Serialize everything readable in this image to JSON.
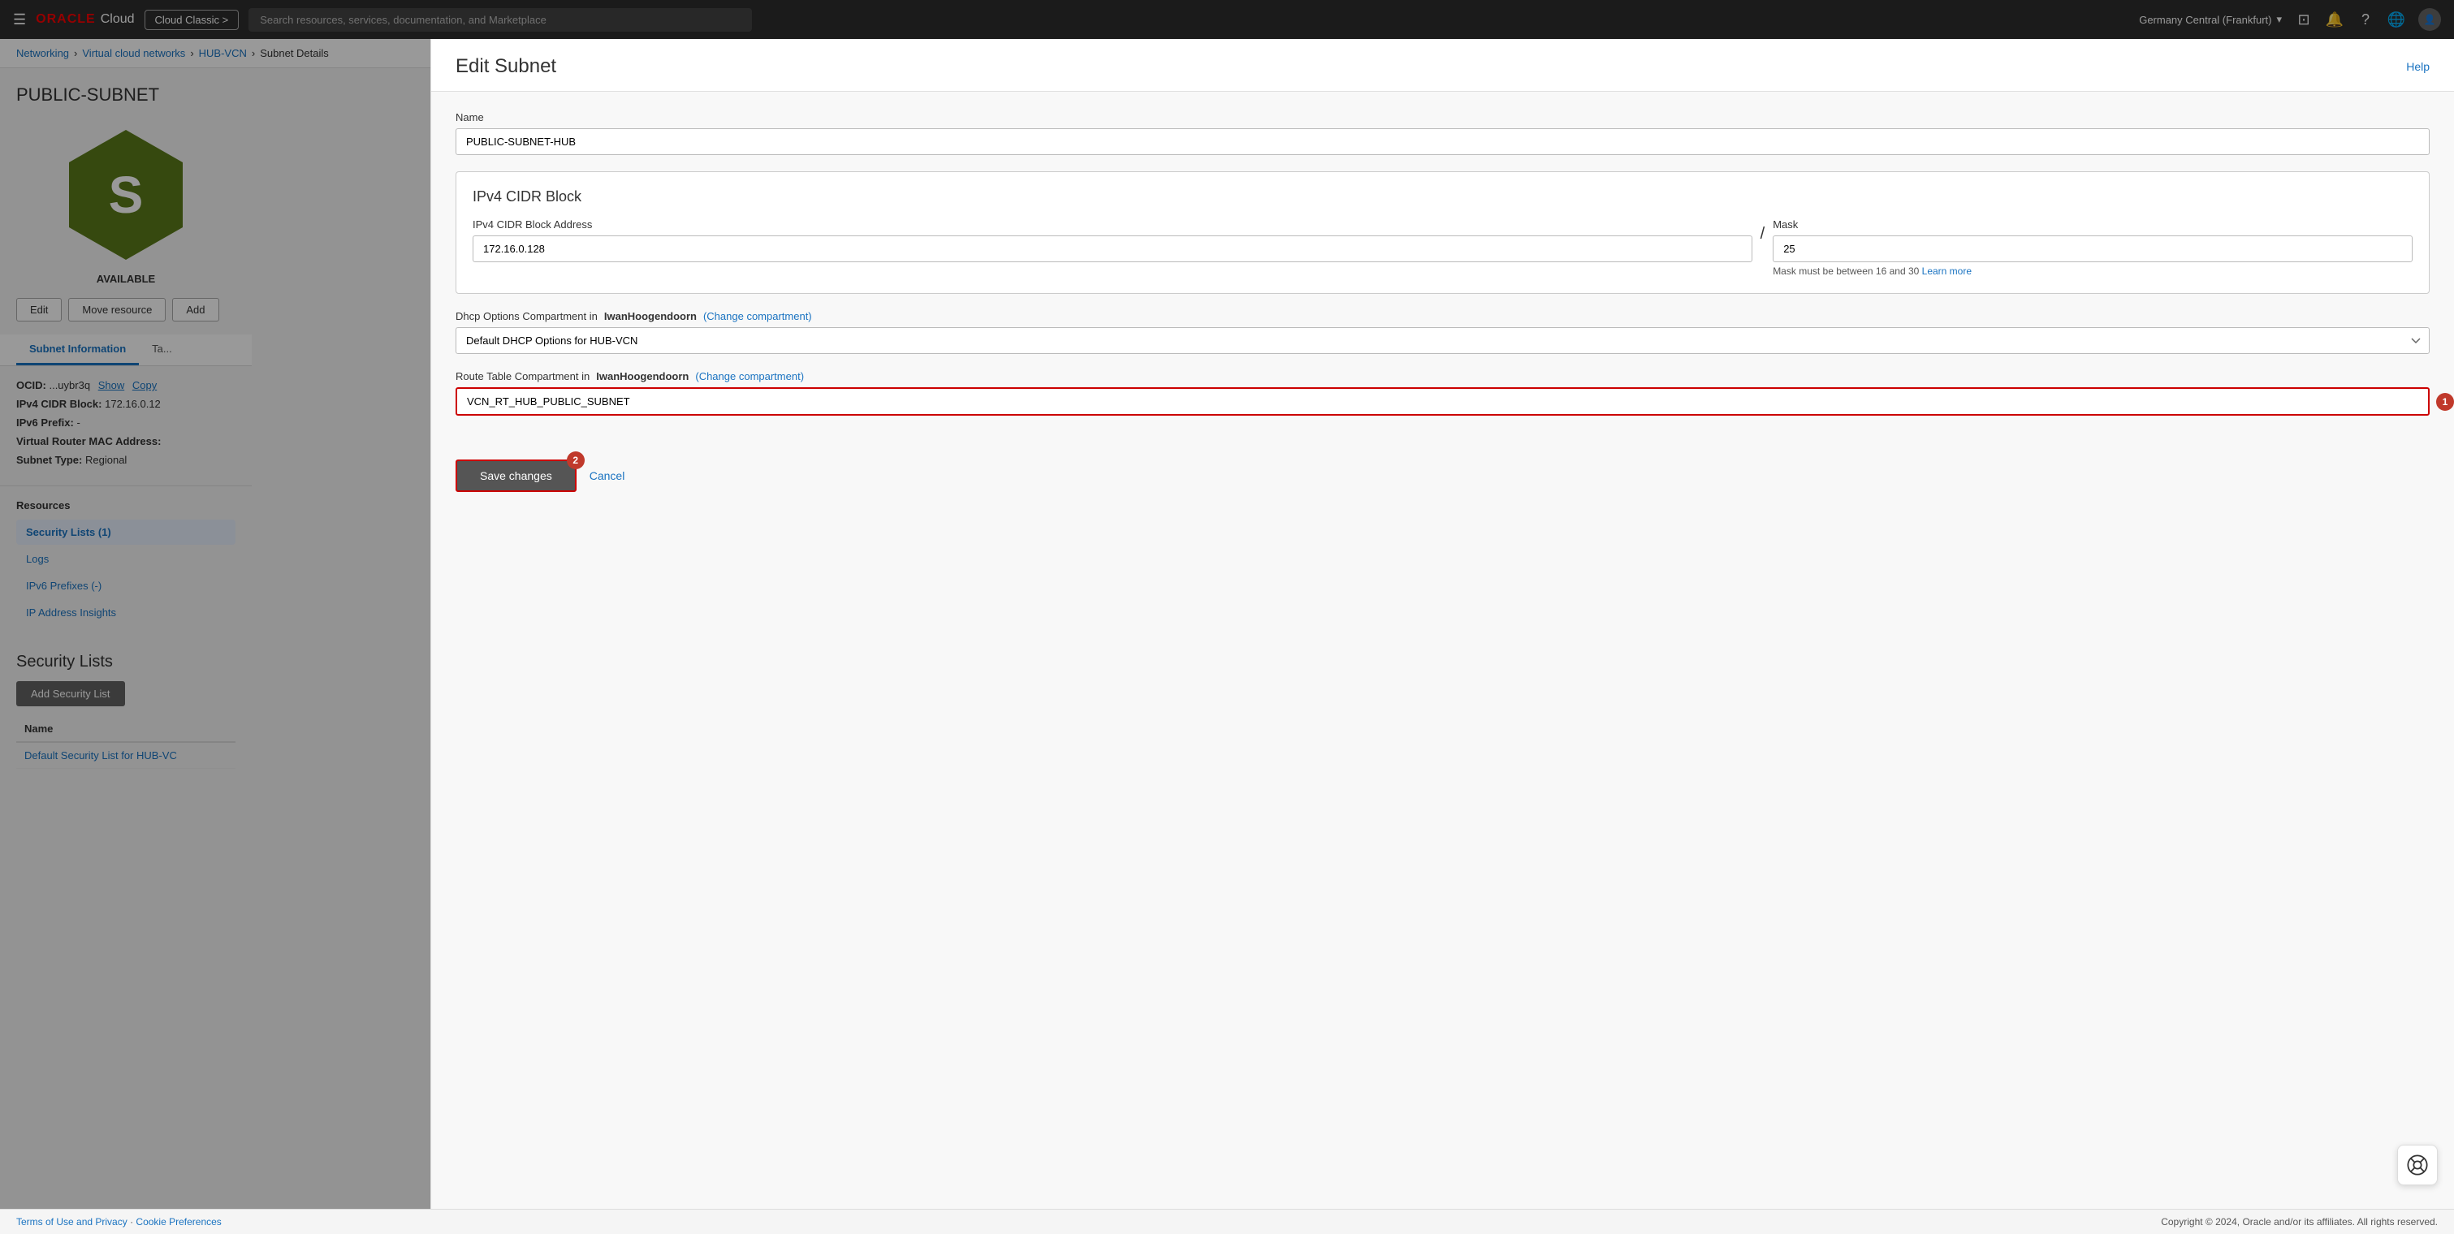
{
  "topnav": {
    "hamburger": "☰",
    "oracle_logo": "ORACLE",
    "oracle_cloud": "Cloud",
    "cloud_classic_btn": "Cloud Classic >",
    "search_placeholder": "Search resources, services, documentation, and Marketplace",
    "region": "Germany Central (Frankfurt)",
    "help_icon": "?",
    "globe_icon": "🌐"
  },
  "breadcrumb": {
    "networking": "Networking",
    "vcn": "Virtual cloud networks",
    "hub_vcn": "HUB-VCN",
    "subnet_details": "Subnet Details"
  },
  "left": {
    "subnet_name": "PUBLIC-SUBNET",
    "hex_letter": "S",
    "status": "AVAILABLE",
    "edit_btn": "Edit",
    "move_btn": "Move resource",
    "add_btn": "Add",
    "tabs": [
      {
        "label": "Subnet Information",
        "active": true
      },
      {
        "label": "Ta..."
      }
    ],
    "info": {
      "ocid_label": "OCID:",
      "ocid_value": "...uybr3q",
      "show_link": "Show",
      "copy_link": "Copy",
      "ipv4_label": "IPv4 CIDR Block:",
      "ipv4_value": "172.16.0.12",
      "ipv6_label": "IPv6 Prefix:",
      "ipv6_value": "-",
      "mac_label": "Virtual Router MAC Address:",
      "subnet_type_label": "Subnet Type:",
      "subnet_type_value": "Regional"
    },
    "resources_title": "Resources",
    "sidebar_nav": [
      {
        "label": "Security Lists (1)",
        "active": true
      },
      {
        "label": "Logs"
      },
      {
        "label": "IPv6 Prefixes (-)"
      },
      {
        "label": "IP Address Insights"
      }
    ],
    "security_lists": {
      "title": "Security Lists",
      "add_btn": "Add Security List",
      "table": {
        "col_name": "Name",
        "rows": [
          {
            "name": "Default Security List for HUB-VC"
          }
        ]
      }
    }
  },
  "edit_panel": {
    "title": "Edit Subnet",
    "help": "Help",
    "name_label": "Name",
    "name_value": "PUBLIC-SUBNET-HUB",
    "cidr_block": {
      "title": "IPv4 CIDR Block",
      "address_label": "IPv4 CIDR Block Address",
      "address_value": "172.16.0.128",
      "mask_label": "Mask",
      "mask_value": "25",
      "mask_hint": "Mask must be between 16 and 30",
      "learn_more": "Learn more"
    },
    "dhcp": {
      "label_prefix": "Dhcp Options Compartment in ",
      "compartment_name": "IwanHoogendoorn",
      "change_link": "(Change compartment)",
      "value": "Default DHCP Options for HUB-VCN"
    },
    "route_table": {
      "label_prefix": "Route Table Compartment in ",
      "compartment_name": "IwanHoogendoorn",
      "change_link": "(Change compartment)",
      "value": "VCN_RT_HUB_PUBLIC_SUBNET",
      "step": "1"
    },
    "save_btn": "Save changes",
    "cancel_link": "Cancel",
    "step2_badge": "2"
  },
  "footer": {
    "terms": "Terms of Use and Privacy",
    "cookies": "Cookie Preferences",
    "copyright": "Copyright © 2024, Oracle and/or its affiliates. All rights reserved."
  }
}
